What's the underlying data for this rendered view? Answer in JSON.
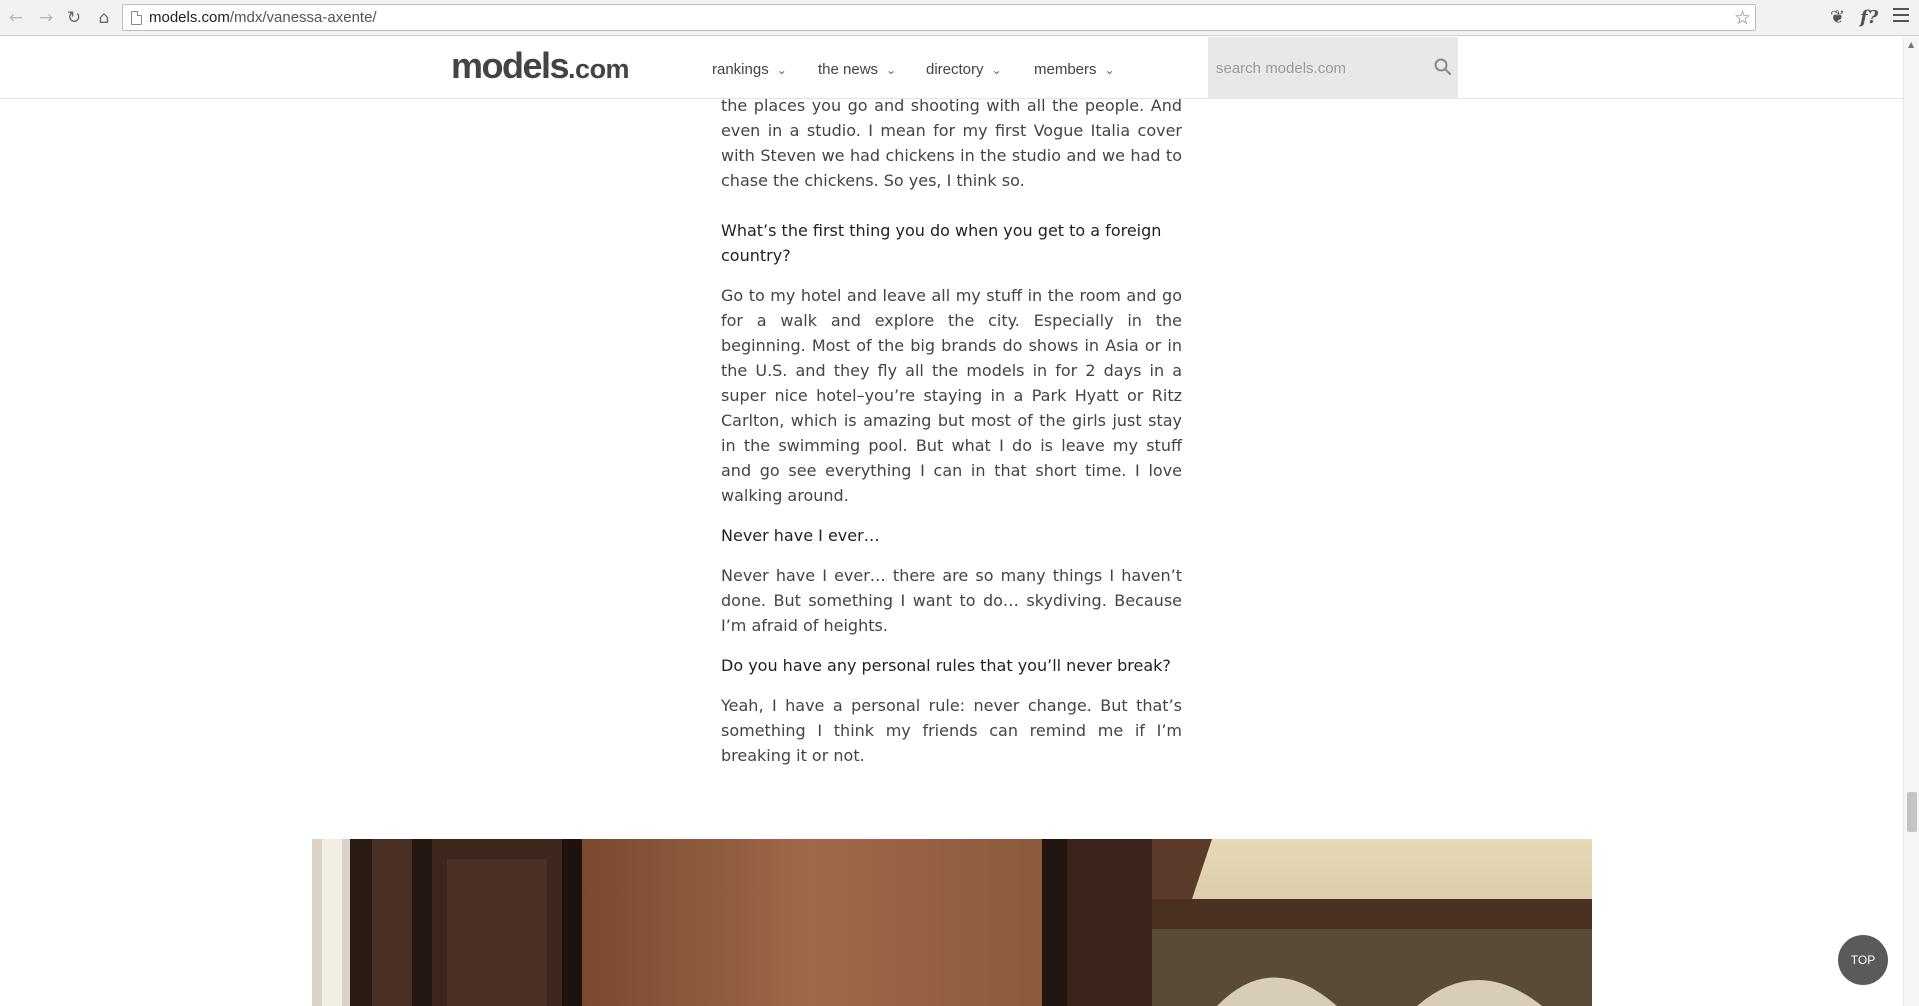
{
  "browser": {
    "url_domain": "models.com",
    "url_path": "/mdx/vanessa-axente/"
  },
  "site": {
    "logo_main": "models",
    "logo_tld": ".com",
    "nav": [
      {
        "label": "rankings"
      },
      {
        "label": "the news"
      },
      {
        "label": "directory"
      },
      {
        "label": "members"
      }
    ],
    "search_placeholder": "search models.com"
  },
  "article": {
    "intro_fragment": "still it’s one of the most amazing jobs you can have… all the places you go and shooting with all the people. And even in a studio. I mean for my first Vogue Italia cover with Steven we had chickens in the studio and we had to chase the chickens. So yes, I think so.",
    "q1": "What’s the first thing you do when you get to a foreign country?",
    "a1": "Go to my hotel and leave all my stuff in the room and go for a walk and explore the city. Especially in the beginning. Most of the big brands do shows in Asia or in the U.S. and they fly all the models in for 2 days in a super nice hotel–you’re staying in a Park Hyatt or Ritz Carlton, which is amazing but most of the girls just stay in the swimming pool. But what I do is leave my stuff and go see everything I can in that short time. I love walking around.",
    "q2": "Never have I ever…",
    "a2": "Never have I ever… there are so many things I haven’t done. But something I want to do… skydiving. Because I’m afraid of heights.",
    "q3": "Do you have any personal rules that you’ll never break?",
    "a3": "Yeah, I have a personal rule: never change. But that’s something I think my friends can remind me if I’m breaking it or not."
  },
  "top_button": "TOP"
}
